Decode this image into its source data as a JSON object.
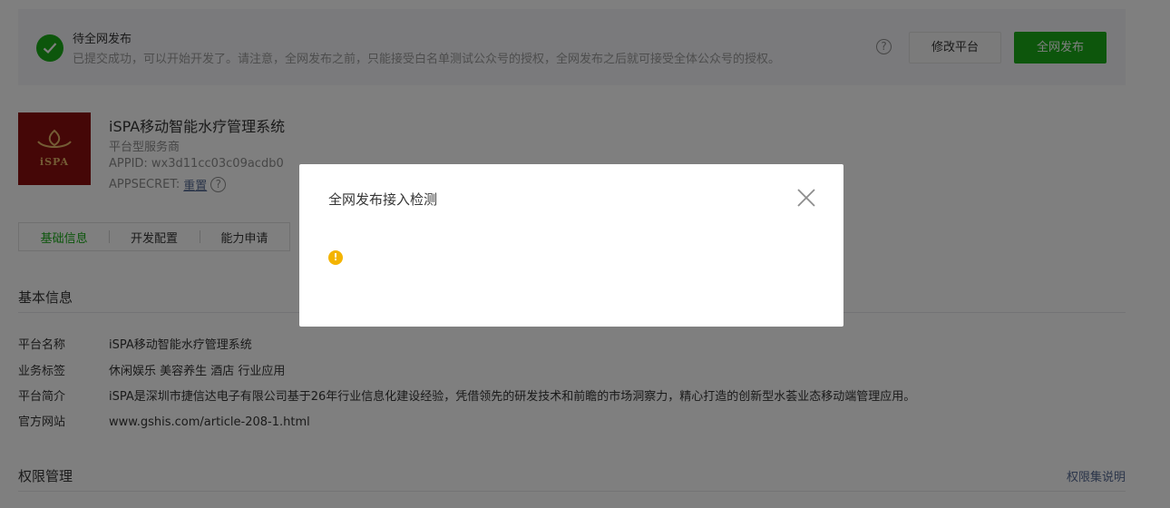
{
  "banner": {
    "title": "待全网发布",
    "description": "已提交成功，可以开始开发了。请注意，全网发布之前，只能接受白名单测试公众号的授权，全网发布之后就可接受全体公众号的授权。",
    "help_icon": "?",
    "modify_button": "修改平台",
    "publish_button": "全网发布"
  },
  "app": {
    "logo_text": "iSPA",
    "name": "iSPA移动智能水疗管理系统",
    "type": "平台型服务商",
    "appid": "APPID: wx3d11cc03c09acdb0",
    "secret_label": "APPSECRET:",
    "secret_link": "重置",
    "help_icon": "?"
  },
  "tabs": [
    {
      "label": "基础信息",
      "active": true
    },
    {
      "label": "开发配置",
      "active": false
    },
    {
      "label": "能力申请",
      "active": false
    }
  ],
  "basic_info": {
    "title": "基本信息",
    "rows": [
      {
        "key": "平台名称",
        "value": "iSPA移动智能水疗管理系统"
      },
      {
        "key": "业务标签",
        "value": "休闲娱乐 美容养生 酒店 行业应用"
      },
      {
        "key": "平台简介",
        "value": "iSPA是深圳市捷信达电子有限公司基于26年行业信息化建设经验，凭借领先的研发技术和前瞻的市场洞察力，精心打造的创新型水荟业态移动端管理应用。"
      },
      {
        "key": "官方网站",
        "value": "www.gshis.com/article-208-1.html"
      }
    ]
  },
  "permissions": {
    "title": "权限管理",
    "link": "权限集说明"
  },
  "dialog": {
    "title": "全网发布接入检测",
    "warn_icon": "!",
    "close_icon": "close-icon"
  },
  "colors": {
    "accent": "#1aad19",
    "link": "#576b95",
    "warning": "#f4b400"
  }
}
